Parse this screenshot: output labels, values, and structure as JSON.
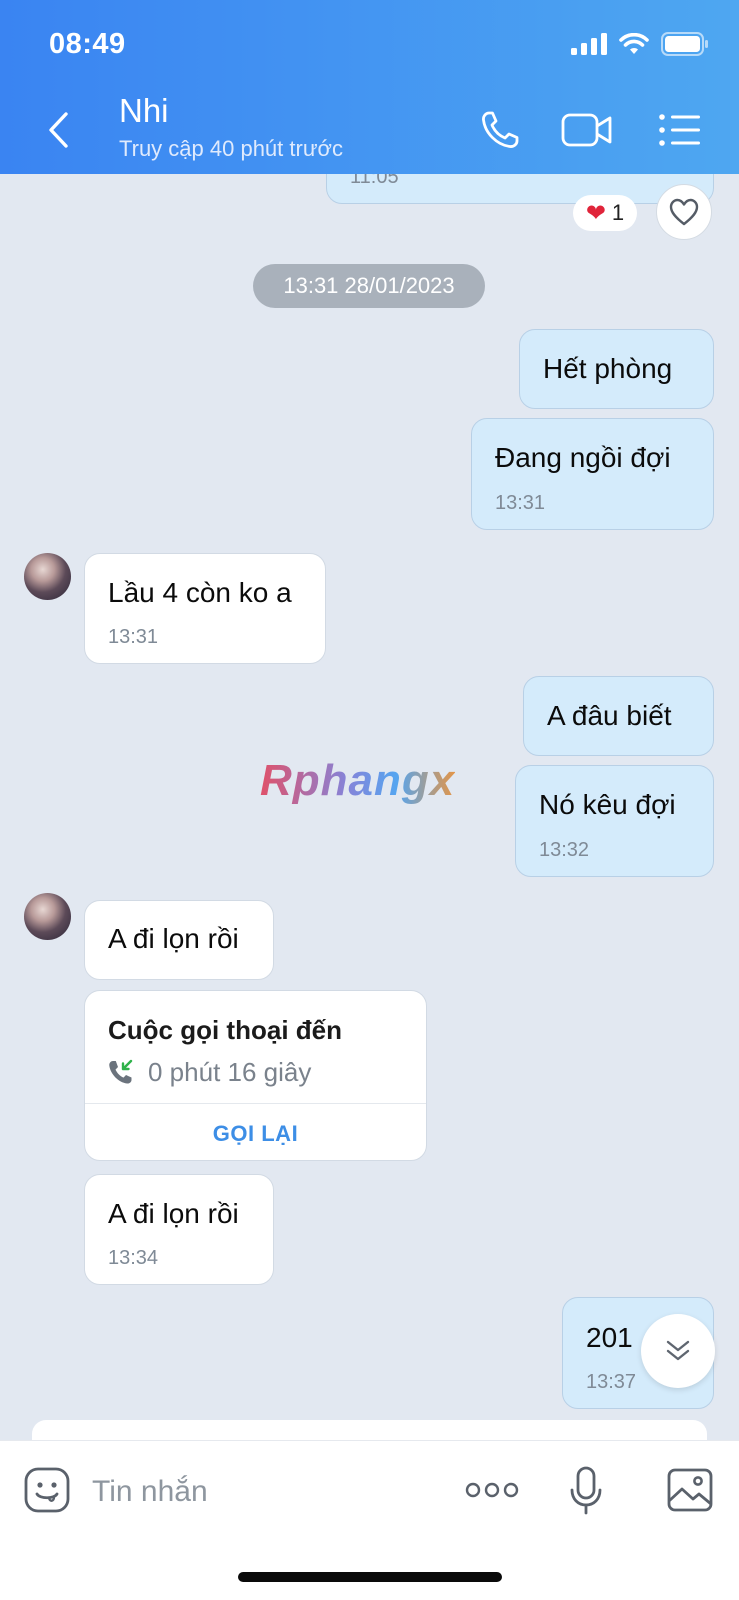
{
  "status_bar": {
    "time": "08:49"
  },
  "header": {
    "name": "Nhi",
    "subtitle": "Truy cập 40 phút trước"
  },
  "partial_top_time": "11:05",
  "reaction": {
    "emoji": "❤️",
    "count": "1"
  },
  "date_separator": "13:31 28/01/2023",
  "messages": [
    {
      "dir": "out",
      "text": "Hết phòng",
      "time": ""
    },
    {
      "dir": "out",
      "text": "Đang ngồi đợi",
      "time": "13:31"
    },
    {
      "dir": "in",
      "text": "Lầu 4 còn ko a",
      "time": "13:31"
    },
    {
      "dir": "out",
      "text": "A đâu biết",
      "time": ""
    },
    {
      "dir": "out",
      "text": "Nó kêu đợi",
      "time": "13:32"
    },
    {
      "dir": "in",
      "text": "A đi lọn rồi",
      "time": ""
    },
    {
      "dir": "in",
      "text": "A đi lọn rồi",
      "time": "13:34"
    },
    {
      "dir": "out",
      "text": "201",
      "time": "13:37"
    }
  ],
  "call_card": {
    "title": "Cuộc gọi thoại đến",
    "duration": "0 phút 16 giây",
    "action": "GỌI LẠI"
  },
  "watermark": "Rphangx",
  "input": {
    "placeholder": "Tin nhắn"
  },
  "colors": {
    "header_start": "#3a84f2",
    "header_end": "#4ea7f1",
    "outgoing_bubble": "#d4ebfb",
    "incoming_bubble": "#ffffff",
    "chat_background": "#e2e8f1",
    "accent": "#3d8ee6"
  }
}
